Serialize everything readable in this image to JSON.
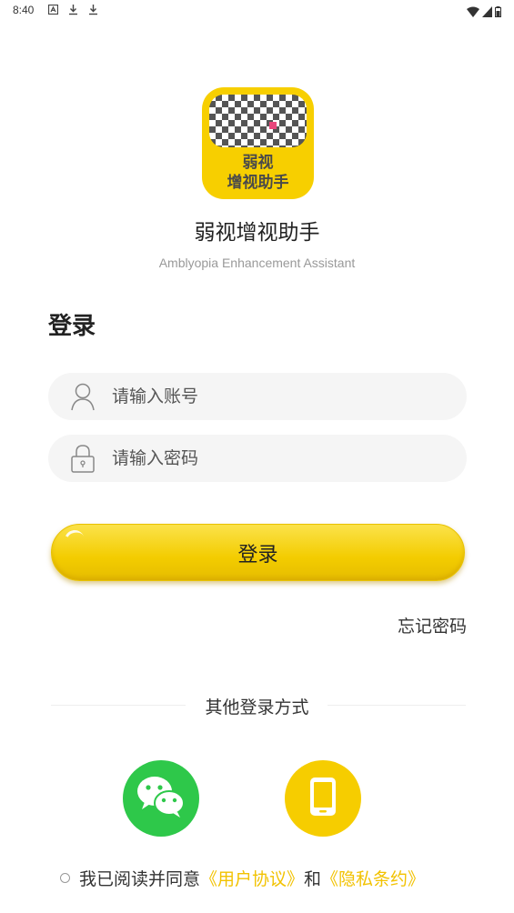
{
  "status_bar": {
    "time": "8:40",
    "left_icons": [
      "a-icon",
      "download-icon",
      "download-icon"
    ],
    "right_icons": [
      "wifi-icon",
      "signal-icon",
      "battery-icon"
    ]
  },
  "logo": {
    "line1": "弱视",
    "line2": "增视助手",
    "accent_color": "#f7cf00",
    "dot_color": "#e8467c"
  },
  "app": {
    "name": "弱视增视助手",
    "subtitle": "Amblyopia Enhancement Assistant"
  },
  "login": {
    "title": "登录",
    "account_placeholder": "请输入账号",
    "password_placeholder": "请输入密码",
    "button_label": "登录",
    "forgot_label": "忘记密码"
  },
  "other_login": {
    "title": "其他登录方式",
    "methods": [
      {
        "icon": "wechat-icon",
        "color": "#2ec84a"
      },
      {
        "icon": "phone-icon",
        "color": "#f6cd00"
      }
    ]
  },
  "agreement": {
    "prefix": "我已阅读并同意",
    "user_agreement": "《用户协议》",
    "conjunction": "和",
    "privacy_policy": "《隐私条约》",
    "link_color": "#f2c200"
  }
}
